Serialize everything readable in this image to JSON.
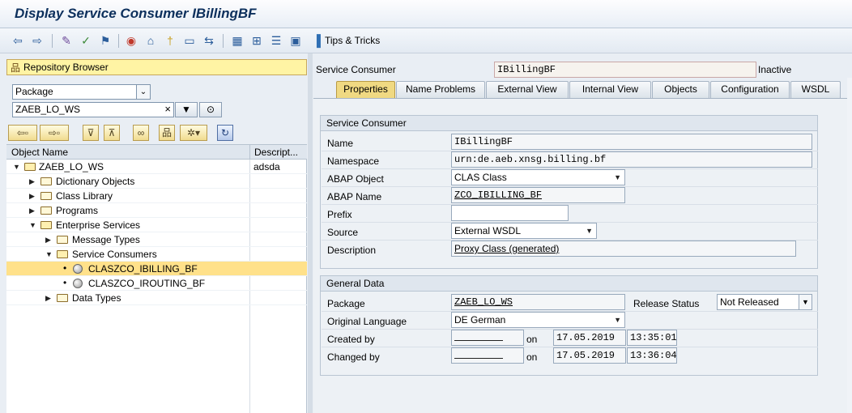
{
  "window": {
    "title": "Display Service Consumer IBillingBF"
  },
  "toolbar": {
    "icons": [
      "back-arrow-icon",
      "forward-arrow-icon",
      "edit-icon",
      "check-icon",
      "activate-icon",
      "where-used-icon",
      "object-list-icon",
      "other-object-icon",
      "navigate-icon",
      "display-object-list-icon",
      "hierarchy-icon",
      "stack-icon",
      "info-icon",
      "tips-icon"
    ],
    "tips_label": "Tips & Tricks"
  },
  "left": {
    "repo_browser_label": "Repository Browser",
    "object_type": "Package",
    "object_name": "ZAEB_LO_WS",
    "clear_glyph": "×",
    "tree_columns": {
      "name": "Object Name",
      "desc": "Descript..."
    },
    "tree_items": [
      {
        "label": "ZAEB_LO_WS",
        "desc": "adsda"
      },
      {
        "label": "Dictionary Objects",
        "desc": ""
      },
      {
        "label": "Class Library",
        "desc": ""
      },
      {
        "label": "Programs",
        "desc": ""
      },
      {
        "label": "Enterprise Services",
        "desc": ""
      },
      {
        "label": "Message Types",
        "desc": ""
      },
      {
        "label": "Service Consumers",
        "desc": ""
      },
      {
        "label": "CLASZCO_IBILLING_BF",
        "desc": ""
      },
      {
        "label": "CLASZCO_IROUTING_BF",
        "desc": ""
      },
      {
        "label": "Data Types",
        "desc": ""
      }
    ]
  },
  "right": {
    "service_consumer_label": "Service Consumer",
    "service_consumer_value": "IBillingBF",
    "status": "Inactive",
    "tabs": [
      "Properties",
      "Name Problems",
      "External View",
      "Internal View",
      "Objects",
      "Configuration",
      "WSDL"
    ],
    "service_consumer_group": {
      "title": "Service Consumer",
      "name_label": "Name",
      "name_value": "IBillingBF",
      "namespace_label": "Namespace",
      "namespace_value": "urn:de.aeb.xnsg.billing.bf",
      "abap_object_label": "ABAP Object",
      "abap_object_value": "CLAS Class",
      "abap_name_label": "ABAP Name",
      "abap_name_value": "ZCO_IBILLING_BF",
      "prefix_label": "Prefix",
      "prefix_value": "",
      "source_label": "Source",
      "source_value": "External WSDL",
      "description_label": "Description",
      "description_value": "Proxy Class (generated)"
    },
    "general_group": {
      "title": "General Data",
      "package_label": "Package",
      "package_value": "ZAEB_LO_WS",
      "release_label": "Release Status",
      "release_value": "Not Released",
      "language_label": "Original Language",
      "language_value": "DE German",
      "created_label": "Created by",
      "created_on": "on",
      "created_date": "17.05.2019",
      "created_time": "13:35:01",
      "changed_label": "Changed by",
      "changed_on": "on",
      "changed_date": "17.05.2019",
      "changed_time": "13:36:04"
    }
  }
}
